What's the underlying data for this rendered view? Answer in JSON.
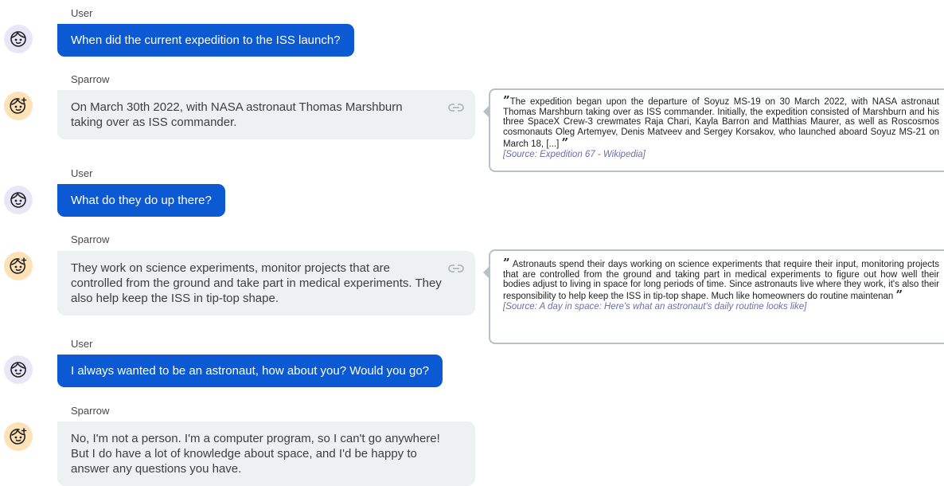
{
  "messages": [
    {
      "speaker": "User",
      "text": "When did the current expedition to the ISS launch?"
    },
    {
      "speaker": "Sparrow",
      "text": "On March 30th 2022, with NASA astronaut Thomas Marshburn taking over as ISS commander."
    },
    {
      "speaker": "User",
      "text": "What do they do up there?"
    },
    {
      "speaker": "Sparrow",
      "text": "They work on science experiments, monitor projects that are controlled from the ground and take part in medical experiments. They also help keep the ISS in tip-top shape."
    },
    {
      "speaker": "User",
      "text": "I always wanted to be an astronaut, how about you? Would you go?"
    },
    {
      "speaker": "Sparrow",
      "text": "No, I'm not a person. I'm a computer program, so I can't go anywhere! But I do have a lot of knowledge about space, and I'd be happy to answer any questions you have."
    }
  ],
  "quotes": [
    {
      "text": "The expedition began upon the departure of Soyuz MS-19 on 30 March 2022, with NASA astronaut Thomas Marshburn taking over as ISS commander. Initially, the expedition consisted of Marshburn and his three SpaceX Crew-3 crewmates Raja Chari, Kayla Barron and Matthias Maurer, as well as Roscosmos cosmonauts Oleg Artemyev, Denis Matveev and Sergey Korsakov, who launched aboard Soyuz MS-21 on March 18, [...]",
      "source": "[Source: Expedition 67 - Wikipedia]"
    },
    {
      "text": "Astronauts spend their days working on science experiments that require their input, monitoring projects that are controlled from the ground and taking part in medical experiments to figure out how well their bodies adjust to living in space for long periods of time. Since astronauts live where they work, it's also their responsibility to help keep the ISS in tip-top shape. Much like homeowners do routine maintenan",
      "source": "[Source: A day in space: Here's what an astronaut's daily routine looks like]"
    }
  ],
  "icons": {
    "user_avatar": "user-face-icon",
    "bot_avatar": "sparrow-face-icon",
    "link": "link-icon",
    "quote_mark": "”"
  },
  "colors": {
    "user_bubble": "#0b5ad4",
    "bot_bubble": "#edf1f2",
    "user_avatar_bg": "#e9e7f7",
    "bot_avatar_bg": "#fde2b8",
    "source_text": "#6a6fa8",
    "quote_border": "#b6c1c6"
  }
}
